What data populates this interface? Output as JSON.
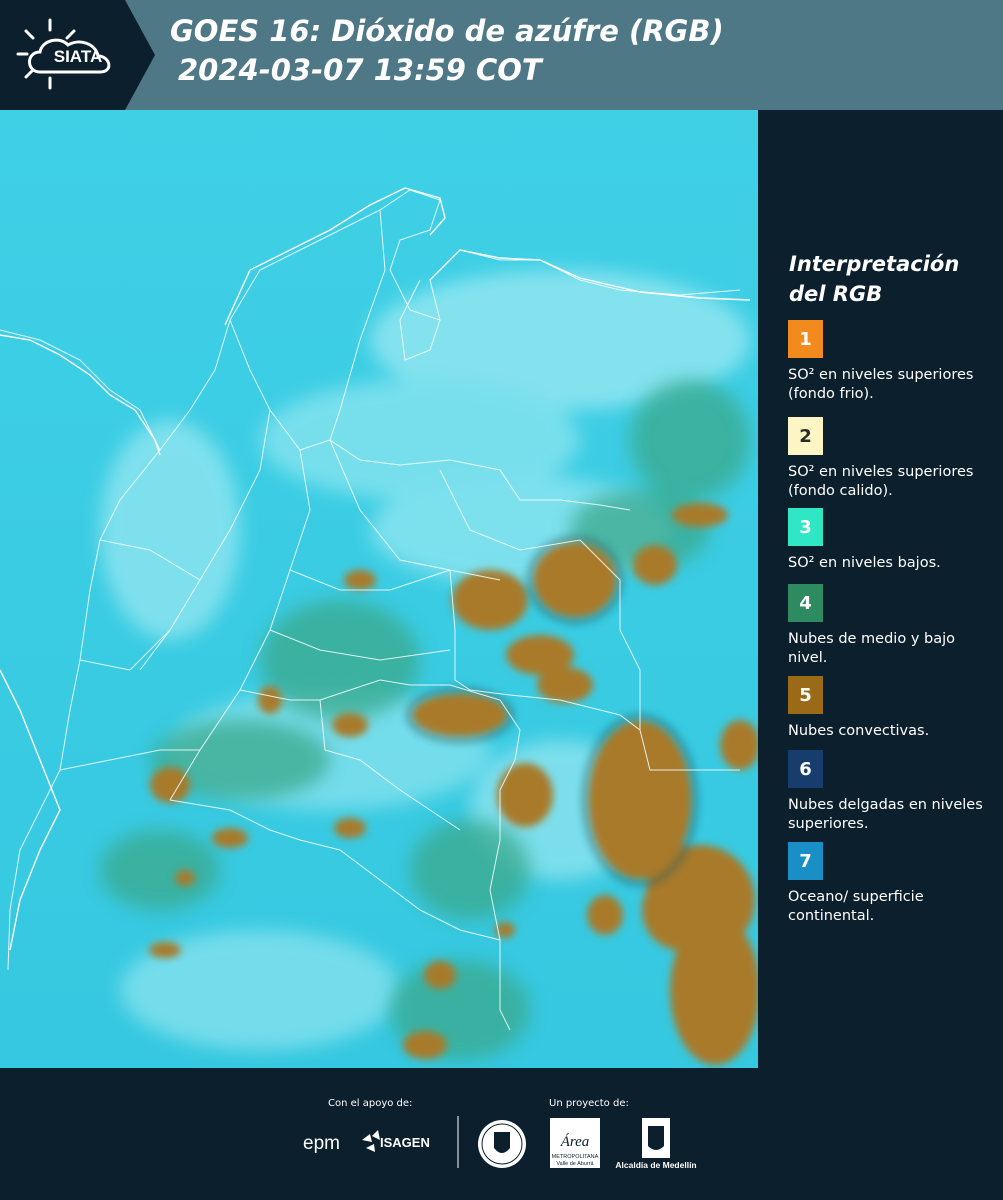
{
  "header": {
    "logo_text": "SIATA",
    "title_line1": "GOES 16: Dióxido de azúfre (RGB)",
    "title_line2": "2024-03-07 13:59 COT"
  },
  "legend": {
    "title_line1": "Interpretación",
    "title_line2": "del RGB",
    "items": [
      {
        "number": "1",
        "color": "#f28a1e",
        "text": "SO² en niveles superiores (fondo frio)."
      },
      {
        "number": "2",
        "color": "#fbf6c4",
        "text": "SO² en niveles superiores (fondo calido)."
      },
      {
        "number": "3",
        "color": "#2fe7c4",
        "text": "SO² en niveles bajos."
      },
      {
        "number": "4",
        "color": "#2d8b5f",
        "text": "Nubes de medio y bajo nivel."
      },
      {
        "number": "5",
        "color": "#9b6a17",
        "text": "Nubes convectivas."
      },
      {
        "number": "6",
        "color": "#163d6e",
        "text": "Nubes delgadas en niveles superiores."
      },
      {
        "number": "7",
        "color": "#1a8ec6",
        "text": "Oceano/ superficie continental."
      }
    ]
  },
  "footer": {
    "support_label": "Con el apoyo de:",
    "project_label": "Un proyecto de:",
    "epm": "epm",
    "isagen": "ISAGEN",
    "area_name": "Área",
    "area_sub1": "METROPOLITANA",
    "area_sub2": "Valle de Aburrá",
    "alcaldia": "Alcaldía de Medellín"
  }
}
